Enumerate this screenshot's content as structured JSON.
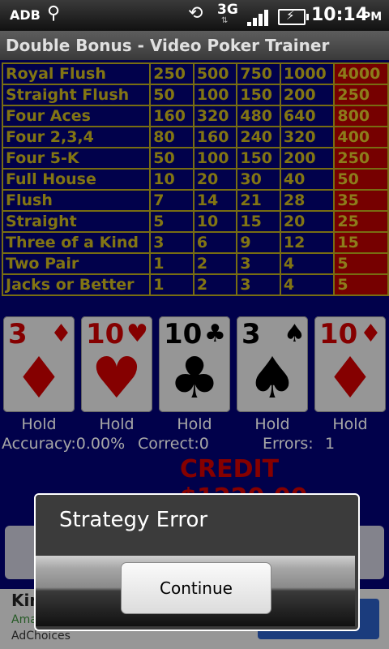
{
  "status_bar": {
    "adb": "ADB",
    "network": "3G",
    "time": "10:14",
    "ampm": "PM"
  },
  "title": "Double Bonus - Video Poker Trainer",
  "pay_table": [
    {
      "hand": "Royal Flush",
      "values": [
        "250",
        "500",
        "750",
        "1000",
        "4000"
      ]
    },
    {
      "hand": "Straight Flush",
      "values": [
        "50",
        "100",
        "150",
        "200",
        "250"
      ]
    },
    {
      "hand": "Four Aces",
      "values": [
        "160",
        "320",
        "480",
        "640",
        "800"
      ]
    },
    {
      "hand": "Four 2,3,4",
      "values": [
        "80",
        "160",
        "240",
        "320",
        "400"
      ]
    },
    {
      "hand": "Four 5-K",
      "values": [
        "50",
        "100",
        "150",
        "200",
        "250"
      ]
    },
    {
      "hand": "Full House",
      "values": [
        "10",
        "20",
        "30",
        "40",
        "50"
      ]
    },
    {
      "hand": "Flush",
      "values": [
        "7",
        "14",
        "21",
        "28",
        "35"
      ]
    },
    {
      "hand": "Straight",
      "values": [
        "5",
        "10",
        "15",
        "20",
        "25"
      ]
    },
    {
      "hand": "Three of a Kind",
      "values": [
        "3",
        "6",
        "9",
        "12",
        "15"
      ]
    },
    {
      "hand": "Two Pair",
      "values": [
        "1",
        "2",
        "3",
        "4",
        "5"
      ]
    },
    {
      "hand": "Jacks or Better",
      "values": [
        "1",
        "2",
        "3",
        "4",
        "5"
      ]
    }
  ],
  "cards": [
    {
      "rank": "3",
      "suit": "♦",
      "color": "red"
    },
    {
      "rank": "10",
      "suit": "♥",
      "color": "red"
    },
    {
      "rank": "10",
      "suit": "♣",
      "color": "black"
    },
    {
      "rank": "3",
      "suit": "♠",
      "color": "black"
    },
    {
      "rank": "10",
      "suit": "♦",
      "color": "red"
    }
  ],
  "hold_labels": [
    "Hold",
    "Hold",
    "Hold",
    "Hold",
    "Hold"
  ],
  "stats": {
    "accuracy": "Accuracy:0.00%",
    "correct": "Correct:0",
    "errors_label": "Errors:",
    "errors_value": "1"
  },
  "credit": "CREDIT $1220.00",
  "ad": {
    "headline": "Kin",
    "sponsor": "Ama",
    "choices": "AdChoices"
  },
  "dialog": {
    "title": "Strategy Error",
    "button": "Continue"
  }
}
